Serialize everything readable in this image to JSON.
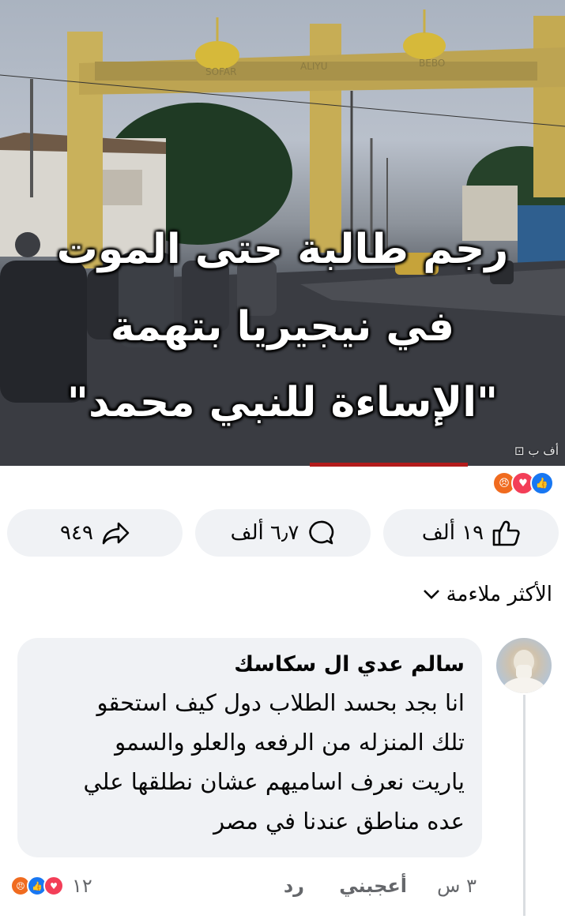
{
  "post": {
    "image": {
      "headline_lines": [
        "رجم طالبة حتى الموت",
        "في نيجيريا بتهمة",
        "\"الإساءة للنبي محمد\""
      ],
      "gate_sign_left": "SOFAR",
      "gate_sign_mid": "ALIYU",
      "gate_sign_right": "BEBO",
      "watermark": "أف ب"
    },
    "reactions": [
      "like",
      "love",
      "angry"
    ],
    "actions": {
      "like_count": "١٩ ألف",
      "comment_count": "٦٫٧ ألف",
      "share_count": "٩٤٩"
    }
  },
  "sort_label": "الأكثر ملاءمة",
  "comment": {
    "author": "سالم عدي ال سكاسك",
    "lines": [
      "انا بجد بحسد الطلاب دول كيف استحقو",
      "تلك المنزله من الرفعه والعلو والسمو",
      "ياريت نعرف اساميهم عشان نطلقها علي",
      "عده مناطق عندنا في مصر"
    ],
    "time": "٣ س",
    "like_label": "أعجبني",
    "reply_label": "رد",
    "reaction_count": "١٢"
  },
  "colors": {
    "like": "#1877f2",
    "love": "#f33e58",
    "angry": "#f06b1f",
    "pill_bg": "#f0f2f5"
  }
}
